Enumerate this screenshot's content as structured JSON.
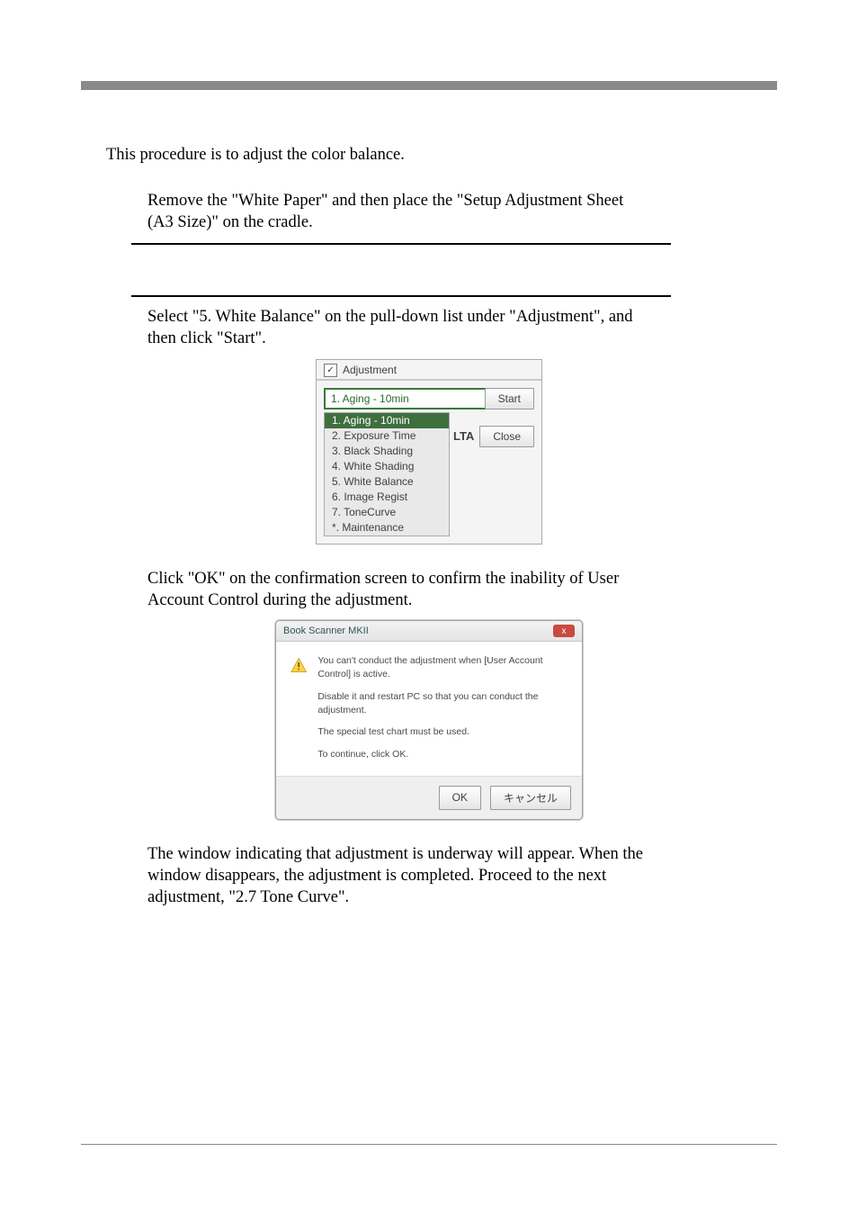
{
  "intro": "This procedure is to adjust the color balance.",
  "step1": "Remove the \"White Paper\" and then place the \"Setup Adjustment Sheet (A3 Size)\" on the cradle.",
  "step2": "Select \"5. White Balance\" on the pull-down list under \"Adjustment\", and then click \"Start\".",
  "step3": "Click \"OK\" on the confirmation screen to confirm the inability of User Account Control during the adjustment.",
  "step4": "The window indicating that adjustment is underway will appear. When the window disappears, the adjustment is completed. Proceed to the next adjustment, \"2.7 Tone Curve\".",
  "adj_panel": {
    "checkbox_mark": "✓",
    "title": "Adjustment",
    "selected": "1. Aging - 10min",
    "dd_arrow": "▾",
    "start_label": "Start",
    "lta_label": "LTA",
    "close_label": "Close",
    "options": {
      "o1": "1. Aging - 10min",
      "o2": "2. Exposure Time",
      "o3": "3. Black Shading",
      "o4": "4. White Shading",
      "o5": "5. White Balance",
      "o6": "6. Image Regist",
      "o7": "7. ToneCurve",
      "o8": "*. Maintenance"
    }
  },
  "dialog": {
    "title": "Book Scanner MKII",
    "close_glyph": "x",
    "line1": "You can't conduct the adjustment when [User Account Control] is active.",
    "line2": "Disable it and restart PC so that you can conduct the adjustment.",
    "line3": "The special test chart must be used.",
    "line4": "To continue, click OK.",
    "ok_label": "OK",
    "cancel_label": "キャンセル"
  }
}
